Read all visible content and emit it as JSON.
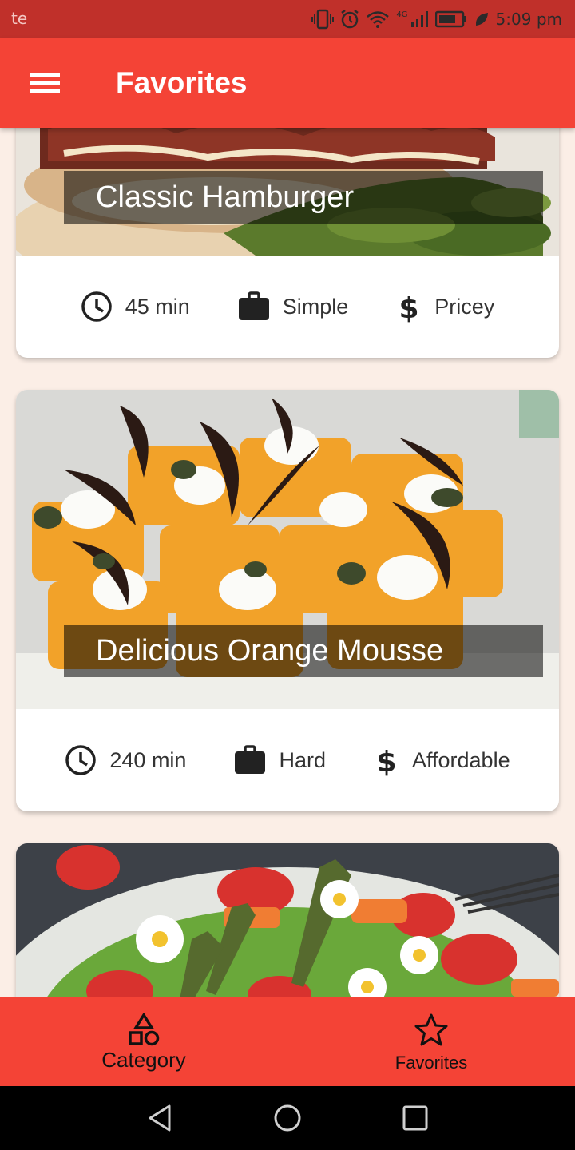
{
  "status_bar": {
    "left_text": "te",
    "network": "4G",
    "time": "5:09 pm",
    "icons": [
      "vibrate-icon",
      "alarm-icon",
      "wifi-icon",
      "signal-icon",
      "battery-icon",
      "leaf-icon"
    ]
  },
  "app_bar": {
    "title": "Favorites",
    "menu_icon": "menu-icon"
  },
  "meals": [
    {
      "title": "Classic Hamburger",
      "duration": "45 min",
      "complexity": "Simple",
      "affordability": "Pricey"
    },
    {
      "title": "Delicious Orange Mousse",
      "duration": "240 min",
      "complexity": "Hard",
      "affordability": "Affordable"
    },
    {
      "title": "",
      "duration": "",
      "complexity": "",
      "affordability": ""
    }
  ],
  "bottom_nav": {
    "items": [
      {
        "label": "Category",
        "icon": "category-icon",
        "selected": false
      },
      {
        "label": "Favorites",
        "icon": "star-icon",
        "selected": true
      }
    ]
  },
  "colors": {
    "primary": "#f44336",
    "status_bar": "#c0302a",
    "background": "#fbeee6"
  }
}
